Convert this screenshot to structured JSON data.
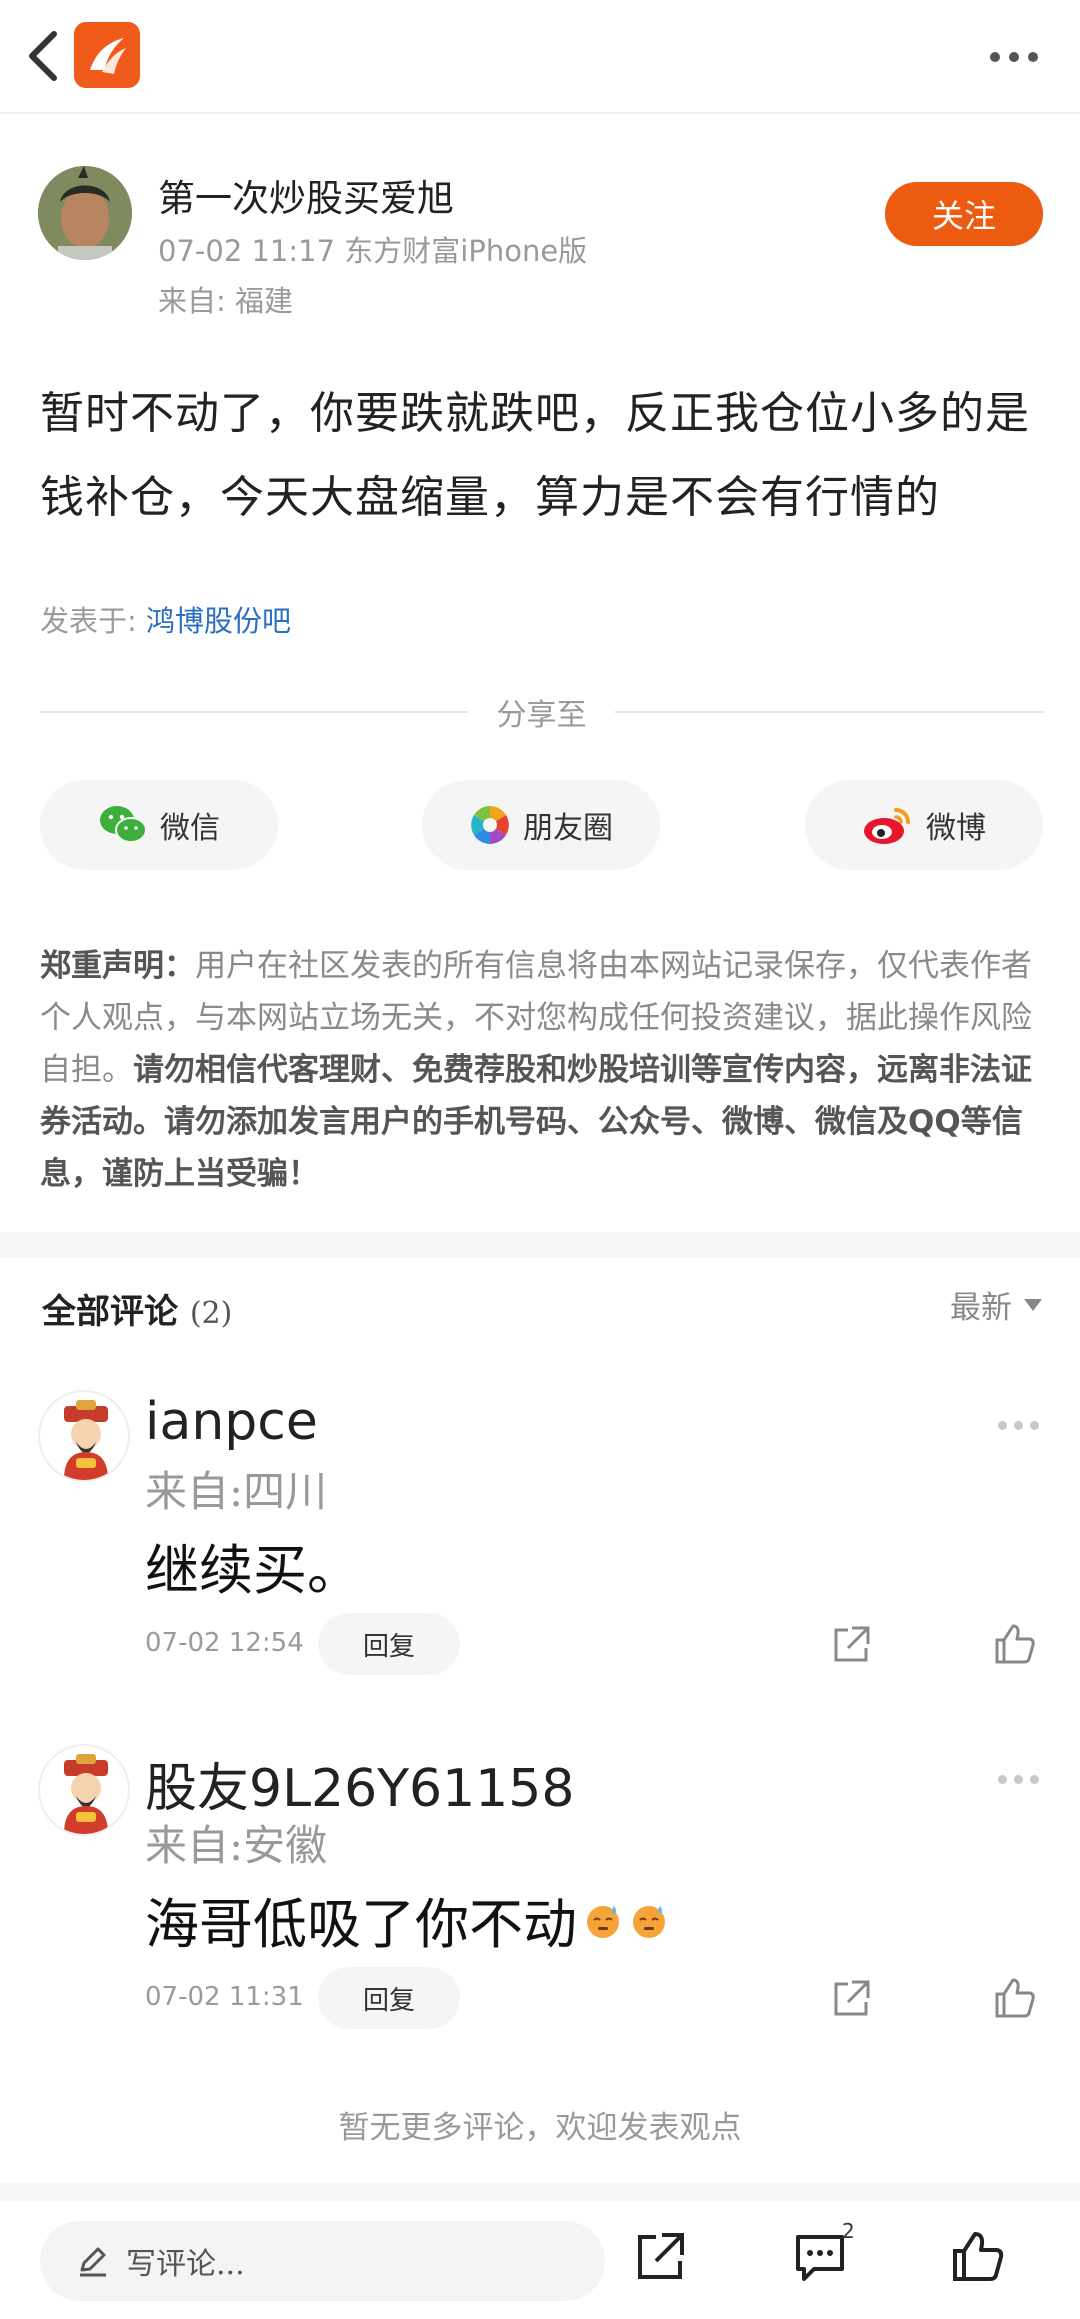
{
  "header": {
    "back_icon": "chevron-left-icon",
    "logo_icon": "eastmoney-logo-icon",
    "more_icon": "more-horizontal-icon"
  },
  "post": {
    "author": "第一次炒股买爱旭",
    "meta": "07-02 11:17 东方财富iPhone版",
    "location": "来自: 福建",
    "follow_label": "关注",
    "body": "暂时不动了，你要跌就跌吧，反正我仓位小多的是钱补仓，今天大盘缩量，算力是不会有行情的",
    "published_prefix": "发表于: ",
    "published_in": "鸿博股份吧"
  },
  "share": {
    "label": "分享至",
    "buttons": [
      {
        "label": "微信",
        "icon": "wechat-icon"
      },
      {
        "label": "朋友圈",
        "icon": "moments-icon"
      },
      {
        "label": "微博",
        "icon": "weibo-icon"
      }
    ]
  },
  "disclaimer": {
    "title": "郑重声明：",
    "normal": "用户在社区发表的所有信息将由本网站记录保存，仅代表作者个人观点，与本网站立场无关，不对您构成任何投资建议，据此操作风险自担。",
    "bold": "请勿相信代客理财、免费荐股和炒股培训等宣传内容，远离非法证券活动。请勿添加发言用户的手机号码、公众号、微博、微信及QQ等信息，谨防上当受骗！"
  },
  "comments": {
    "title": "全部评论",
    "count": "(2)",
    "sort_label": "最新",
    "items": [
      {
        "user": "ianpce",
        "location": "来自:四川",
        "text": "继续买。",
        "emoji_count": 0,
        "time": "07-02 12:54",
        "reply_label": "回复"
      },
      {
        "user": "股友9L26Y61158",
        "location": "来自:安徽",
        "text": "海哥低吸了你不动",
        "emoji_count": 2,
        "time": "07-02 11:31",
        "reply_label": "回复"
      }
    ],
    "no_more": "暂无更多评论，欢迎发表观点"
  },
  "bottom_bar": {
    "write_placeholder": "写评论...",
    "comment_badge": "2",
    "icons": [
      "edit-icon",
      "share-icon",
      "comment-icon",
      "like-icon"
    ]
  },
  "colors": {
    "accent": "#ec5b10",
    "link": "#2a6fc2"
  }
}
